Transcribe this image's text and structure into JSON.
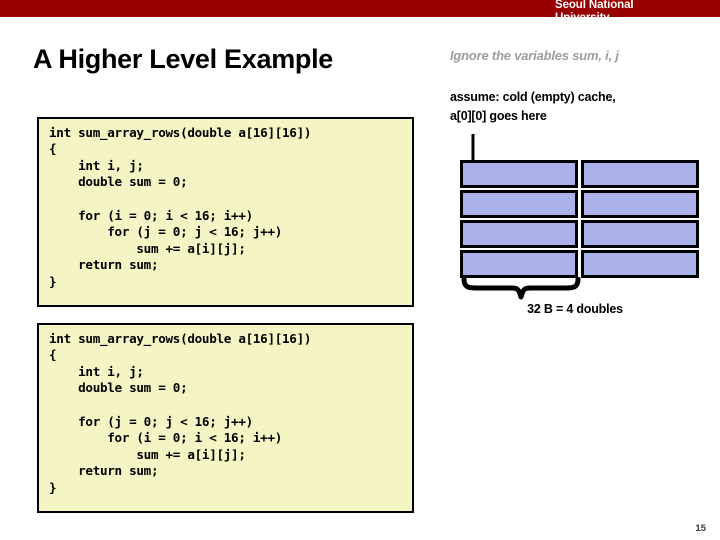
{
  "header": {
    "brand": "Seoul National\nUniversity",
    "band_color": "#990000"
  },
  "slide": {
    "title": "A Higher Level Example",
    "page_number": "15"
  },
  "notes": {
    "ignore": "Ignore the variables sum, i, j",
    "assume": "assume: cold (empty) cache,\na[0][0] goes here"
  },
  "code_blocks": [
    {
      "id": "row-major",
      "text": "int sum_array_rows(double a[16][16])\n{\n    int i, j;\n    double sum = 0;\n\n    for (i = 0; i < 16; i++)\n        for (j = 0; j < 16; j++)\n            sum += a[i][j];\n    return sum;\n}",
      "background": "#f4f4c4"
    },
    {
      "id": "col-major",
      "text": "int sum_array_rows(double a[16][16])\n{\n    int i, j;\n    double sum = 0;\n\n    for (j = 0; j < 16; j++)\n        for (i = 0; i < 16; i++)\n            sum += a[i][j];\n    return sum;\n}",
      "background": "#f4f4c4"
    }
  ],
  "cache_diagram": {
    "block_fill": "#aab0e8",
    "block_border": "#000000",
    "rows": 4,
    "columns": 2,
    "brace_label": "32 B = 4 doubles"
  }
}
